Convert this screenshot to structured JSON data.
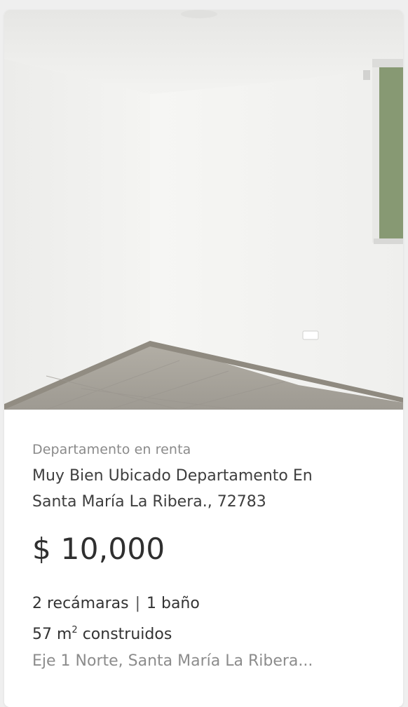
{
  "listing": {
    "type": "Departamento en renta",
    "title_line1": "Muy Bien Ubicado Departamento En",
    "title_line2": "Santa María La Ribera., 72783",
    "price": "$ 10,000",
    "bedrooms": "2 recámaras",
    "separator": "|",
    "bathrooms": "1 baño",
    "area_value": "57 m",
    "area_sup": "2",
    "area_label": "construidos",
    "address": "Eje 1 Norte, Santa María La Ribera..."
  },
  "colors": {
    "wall": "#f2f2f0",
    "floor": "#a9a59c",
    "baseboard": "#8f8a80"
  }
}
